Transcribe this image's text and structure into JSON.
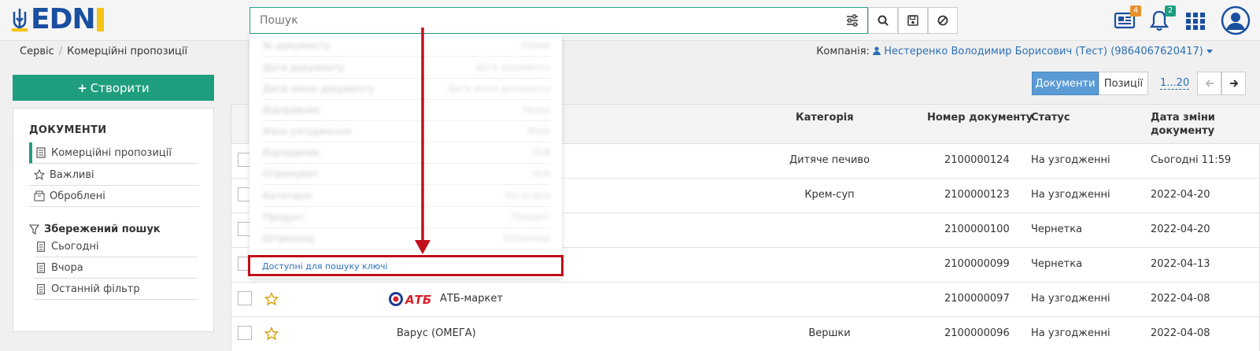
{
  "header": {
    "search": {
      "placeholder": "Пошук",
      "value": ""
    },
    "badges": {
      "news": "4",
      "notifications": "2"
    },
    "colors": {
      "accent": "#1f9d7f",
      "brand": "#1a4fa0",
      "news_badge": "#e8912d",
      "notif_badge": "#1f9d7f"
    }
  },
  "breadcrumb": {
    "items": [
      "Сервіс",
      "Комерційні пропозиції"
    ]
  },
  "company": {
    "label": "Компанія:",
    "value": "Нестеренко Володимир Борисович (Тест) (9864067620417)"
  },
  "sidebar": {
    "create_label": "Створити",
    "section_title": "ДОКУМЕНТИ",
    "items": [
      {
        "label": "Комерційні пропозиції",
        "active": true
      },
      {
        "label": "Важливі"
      },
      {
        "label": "Оброблені"
      }
    ],
    "saved_title": "Збережений пошук",
    "saved_items": [
      {
        "label": "Сьогодні"
      },
      {
        "label": "Вчора"
      },
      {
        "label": "Останній фільтр"
      }
    ]
  },
  "toolbar": {
    "docs_label": "Документи",
    "pos_label": "Позиції",
    "pager": "1...20"
  },
  "table": {
    "headers": {
      "category": "Категорія",
      "docnum": "Номер документу",
      "status": "Статус",
      "date": "Дата зміни документу"
    },
    "rows": [
      {
        "partner": "",
        "category": "Дитяче печиво",
        "docnum": "2100000124",
        "status": "На узгодженні",
        "date": "Сьогодні 11:59"
      },
      {
        "partner": "",
        "category": "Крем-суп",
        "docnum": "2100000123",
        "status": "На узгодженні",
        "date": "2022-04-20"
      },
      {
        "partner": "",
        "category": "",
        "docnum": "2100000100",
        "status": "Чернетка",
        "date": "2022-04-20"
      },
      {
        "partner": "",
        "category": "",
        "docnum": "2100000099",
        "status": "Чернетка",
        "date": "2022-04-13"
      },
      {
        "partner": "АТБ-маркет",
        "category": "",
        "docnum": "2100000097",
        "status": "На узгодженні",
        "date": "2022-04-08"
      },
      {
        "partner": "Варус (ОМЕГА)",
        "category": "Вершки",
        "docnum": "2100000096",
        "status": "На узгодженні",
        "date": "2022-04-08"
      }
    ]
  },
  "dropdown": {
    "blurred_keys": [
      {
        "k": "№ документу",
        "v": "Номер"
      },
      {
        "k": "Дата документу",
        "v": "Дата документу"
      },
      {
        "k": "Дата зміни документу",
        "v": "Дата зміни документу"
      },
      {
        "k": "Відправник",
        "v": "Назва"
      },
      {
        "k": "Фаза узгодження",
        "v": "Фаза"
      },
      {
        "k": "Відправник",
        "v": "GLN"
      },
      {
        "k": "Отримувач",
        "v": "GLN"
      },
      {
        "k": "Категорія",
        "v": "Категорія"
      },
      {
        "k": "Продукт",
        "v": "Продукт"
      },
      {
        "k": "Штрихкод",
        "v": "Штрихкод"
      }
    ],
    "footer_label": "Доступні для пошуку ключі"
  }
}
